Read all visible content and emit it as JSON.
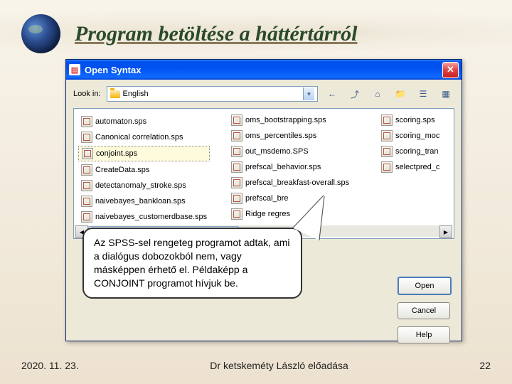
{
  "header": {
    "title": "Program betöltése a háttértárról"
  },
  "dialog": {
    "title": "Open Syntax",
    "lookin_label": "Look in:",
    "folder": "English",
    "files_col1": [
      "automaton.sps",
      "Canonical correlation.sps",
      "conjoint.sps",
      "CreateData.sps",
      "detectanomaly_stroke.sps",
      "naivebayes_bankloan.sps"
    ],
    "files_col2": [
      "naivebayes_customerdbase.sps",
      "oms_bootstrapping.sps",
      "oms_percentiles.sps",
      "out_msdemo.SPS",
      "prefscal_behavior.sps",
      "prefscal_breakfast-overall.sps"
    ],
    "files_col3": [
      "prefscal_bre",
      "Ridge regres",
      "scoring.sps",
      "scoring_moc",
      "scoring_tran",
      "selectpred_c"
    ],
    "selected": "conjoint.sps",
    "buttons": {
      "open": "Open",
      "cancel": "Cancel",
      "help": "Help"
    }
  },
  "callout": "Az SPSS-sel rengeteg programot adtak, ami a dialógus dobozokból nem, vagy másképpen érhető el. Példaképp a CONJOINT programot hívjuk be.",
  "footer": {
    "date": "2020. 11. 23.",
    "center": "Dr ketskeméty László előadása",
    "page": "22"
  }
}
